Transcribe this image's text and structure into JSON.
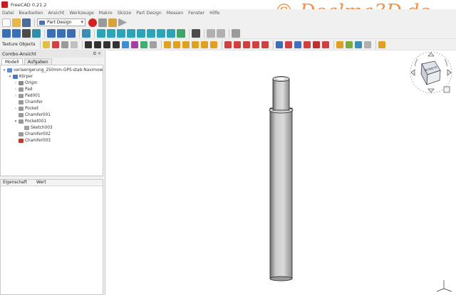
{
  "window": {
    "title": "FreeCAD 0.21.2"
  },
  "watermark": "© Dealma3D.de",
  "menu": [
    "Datei",
    "Bearbeiten",
    "Ansicht",
    "Werkzeuge",
    "Makro",
    "Skizze",
    "Part Design",
    "Messen",
    "Fenster",
    "Hilfe"
  ],
  "toolbar": {
    "workbench": "Part Design",
    "texture_label": "Texture Objects"
  },
  "combo_view": {
    "title": "Combo-Ansicht",
    "tabs": [
      "Modell",
      "Aufgaben"
    ],
    "tree": [
      {
        "label": "verlaengerung_250mm-GPS-stab-Navimow",
        "depth": 0,
        "expander": "▾",
        "icon": "document-icon",
        "color": "#5a8fd0"
      },
      {
        "label": "Körper",
        "depth": 1,
        "expander": "▾",
        "icon": "body-icon",
        "color": "#4a78b8"
      },
      {
        "label": "Origin",
        "depth": 2,
        "expander": "›",
        "icon": "origin-icon",
        "color": "#8a8a8a"
      },
      {
        "label": "Pad",
        "depth": 2,
        "expander": "›",
        "icon": "pad-icon",
        "color": "#9a9a9a"
      },
      {
        "label": "Pad001",
        "depth": 2,
        "expander": "›",
        "icon": "pad-icon",
        "color": "#9a9a9a"
      },
      {
        "label": "Chamfer",
        "depth": 2,
        "expander": "",
        "icon": "chamfer-icon",
        "color": "#9a9a9a"
      },
      {
        "label": "Pocket",
        "depth": 2,
        "expander": "›",
        "icon": "pocket-icon",
        "color": "#9a9a9a"
      },
      {
        "label": "Chamfer001",
        "depth": 2,
        "expander": "",
        "icon": "chamfer-icon",
        "color": "#9a9a9a"
      },
      {
        "label": "Pocket001",
        "depth": 2,
        "expander": "▾",
        "icon": "pocket-icon",
        "color": "#9a9a9a"
      },
      {
        "label": "Sketch003",
        "depth": 3,
        "expander": "",
        "icon": "sketch-icon",
        "color": "#a0a0a0"
      },
      {
        "label": "Chamfer002",
        "depth": 2,
        "expander": "",
        "icon": "chamfer-icon",
        "color": "#9a9a9a"
      },
      {
        "label": "Chamfer003",
        "depth": 2,
        "expander": "",
        "icon": "chamfer-icon",
        "color": "#c0392b"
      }
    ]
  },
  "property_view": {
    "columns": [
      "Eigenschaft",
      "Wert"
    ]
  },
  "navcube": {
    "face_label": "ISOMETR"
  },
  "colors": {
    "accent": "#f0883a",
    "record": "#d42020",
    "model": "#c8c8c8"
  }
}
